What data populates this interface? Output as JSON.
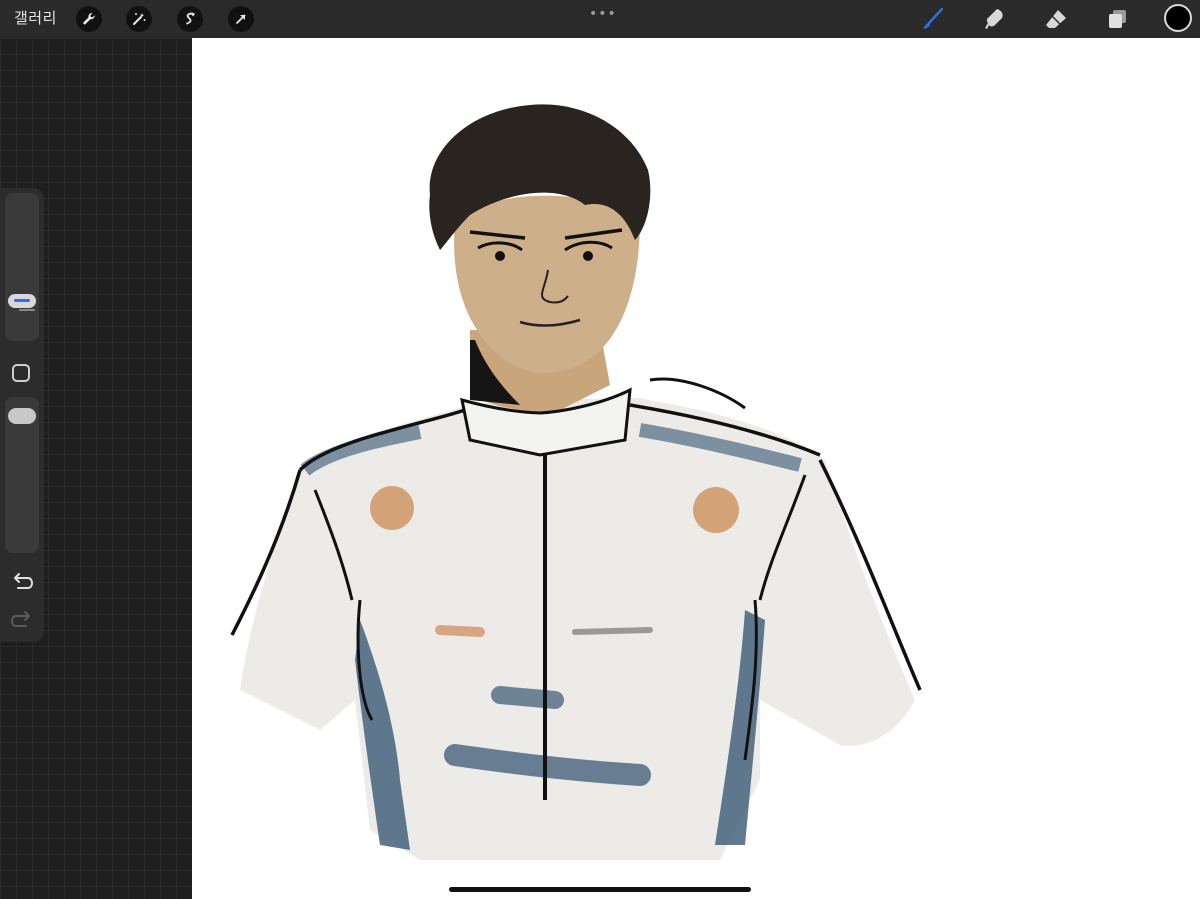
{
  "toolbar": {
    "gallery_label": "갤러리",
    "left_icons": [
      "wrench-icon",
      "magic-wand-icon",
      "selection-icon",
      "transform-arrow-icon"
    ],
    "right_icons": [
      "brush-icon",
      "smudge-icon",
      "eraser-icon",
      "layers-icon"
    ],
    "active_tool": "brush",
    "current_color": "#000000",
    "accent_color": "#2f6fe8"
  },
  "sidebar": {
    "controls": [
      "brush-size-slider",
      "modify-button",
      "opacity-slider",
      "undo-button",
      "redo-button"
    ]
  },
  "canvas": {
    "background": "#ffffff"
  }
}
